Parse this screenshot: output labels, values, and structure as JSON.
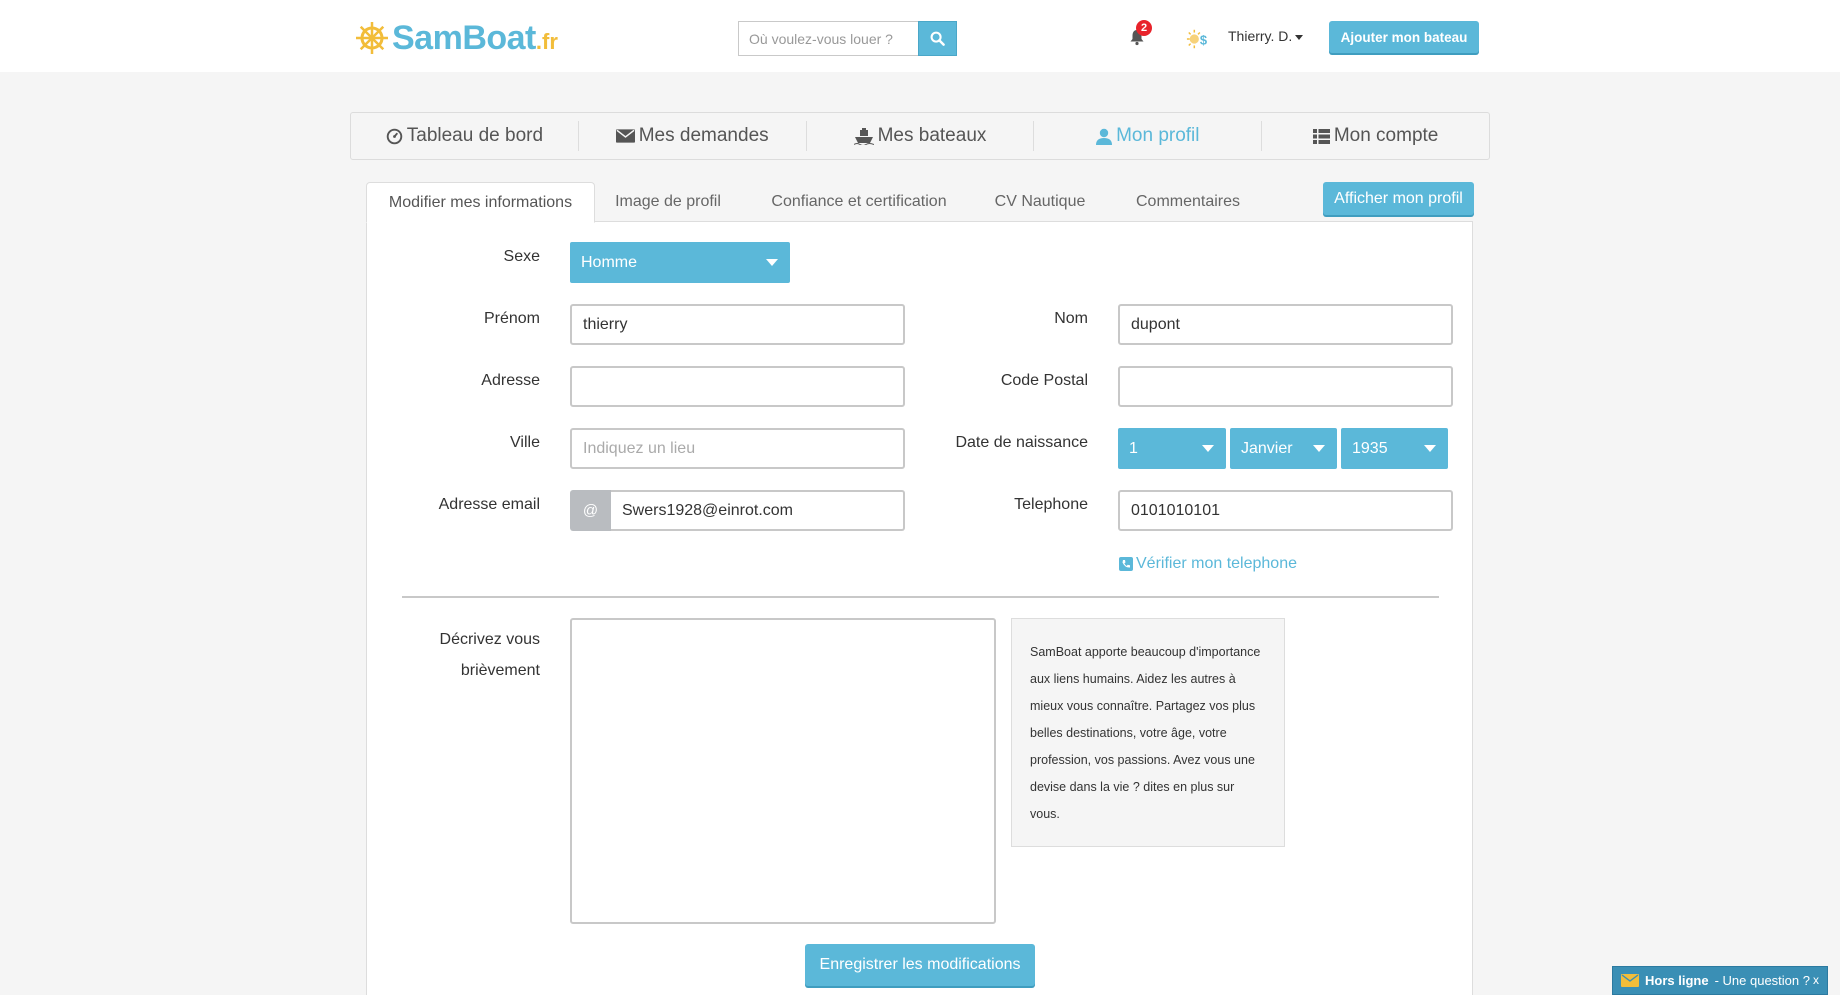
{
  "header": {
    "brand": "SamBoat",
    "tld": ".fr",
    "search_placeholder": "Où voulez-vous louer ?",
    "notification_count": "2",
    "user_name": "Thierry. D.",
    "add_boat_label": "Ajouter mon bateau"
  },
  "main_nav": [
    {
      "label": "Tableau de bord",
      "icon": "dashboard-icon"
    },
    {
      "label": "Mes demandes",
      "icon": "envelope-icon"
    },
    {
      "label": "Mes bateaux",
      "icon": "boat-icon"
    },
    {
      "label": "Mon profil",
      "icon": "user-icon",
      "active": true
    },
    {
      "label": "Mon compte",
      "icon": "list-icon"
    }
  ],
  "tabs": [
    {
      "label": "Modifier mes informations",
      "active": true
    },
    {
      "label": "Image de profil"
    },
    {
      "label": "Confiance et certification"
    },
    {
      "label": "CV Nautique"
    },
    {
      "label": "Commentaires"
    }
  ],
  "show_profile_label": "Afficher mon profil",
  "form": {
    "sexe_label": "Sexe",
    "sexe_value": "Homme",
    "prenom_label": "Prénom",
    "prenom_value": "thierry",
    "nom_label": "Nom",
    "nom_value": "dupont",
    "adresse_label": "Adresse",
    "adresse_value": "",
    "code_postal_label": "Code Postal",
    "code_postal_value": "",
    "ville_label": "Ville",
    "ville_placeholder": "Indiquez un lieu",
    "date_label": "Date de naissance",
    "date_day": "1",
    "date_month": "Janvier",
    "date_year": "1935",
    "email_label": "Adresse email",
    "email_prefix": "@",
    "email_value": "Swers1928@einrot.com",
    "telephone_label": "Telephone",
    "telephone_value": "0101010101",
    "verify_label": "Vérifier mon telephone",
    "describe_label_1": "Décrivez vous",
    "describe_label_2": "brièvement",
    "help_text": "SamBoat apporte beaucoup d'importance aux liens humains. Aidez les autres à mieux vous connaître. Partagez vos plus belles destinations, votre âge, votre profession, vos passions. Avez vous une devise dans la vie ? dites en plus sur vous.",
    "save_label": "Enregistrer les modifications"
  },
  "chat": {
    "status": "Hors ligne",
    "question": "- Une question ?",
    "close": "x"
  },
  "colors": {
    "accent": "#5bb8d9",
    "logo_yellow": "#f2bd3a",
    "badge_red": "#e8232b"
  }
}
